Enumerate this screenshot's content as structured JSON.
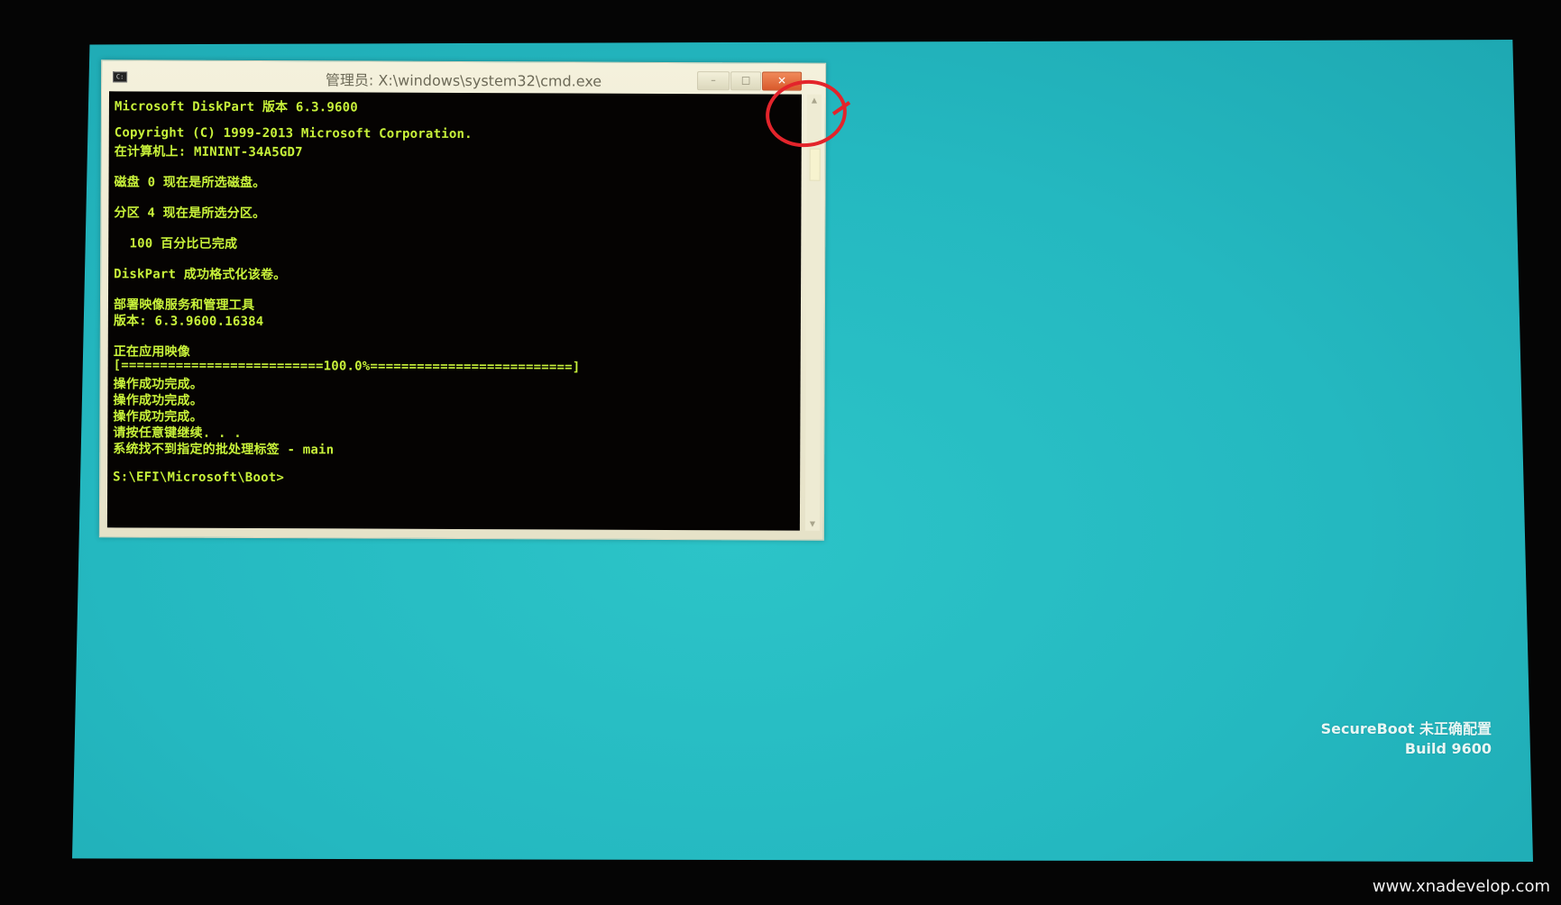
{
  "window": {
    "title": "管理员: X:\\windows\\system32\\cmd.exe",
    "icon": "cmd-icon",
    "minimize_glyph": "–",
    "maximize_glyph": "□",
    "close_glyph": "✕"
  },
  "console": {
    "text_color": "#c8f23a",
    "background": "#050302",
    "lines": [
      "Microsoft DiskPart 版本 6.3.9600",
      "Copyright (C) 1999-2013 Microsoft Corporation.",
      "在计算机上: MININT-34A5GD7",
      "磁盘 0 现在是所选磁盘。",
      "分区 4 现在是所选分区。",
      "  100 百分比已完成",
      "DiskPart 成功格式化该卷。",
      "部署映像服务和管理工具",
      "版本: 6.3.9600.16384",
      "正在应用映像",
      "[==========================100.0%==========================]",
      "操作成功完成。",
      "操作成功完成。",
      "操作成功完成。",
      "请按任意键继续. . .",
      "系统找不到指定的批处理标签 - main",
      "S:\\EFI\\Microsoft\\Boot>"
    ]
  },
  "desktop": {
    "background": "#24b8c0",
    "status_line1": "SecureBoot 未正确配置",
    "status_line2": "Build 9600"
  },
  "annotation": {
    "color": "#e3242b"
  },
  "watermark": "www.xnadevelop.com"
}
